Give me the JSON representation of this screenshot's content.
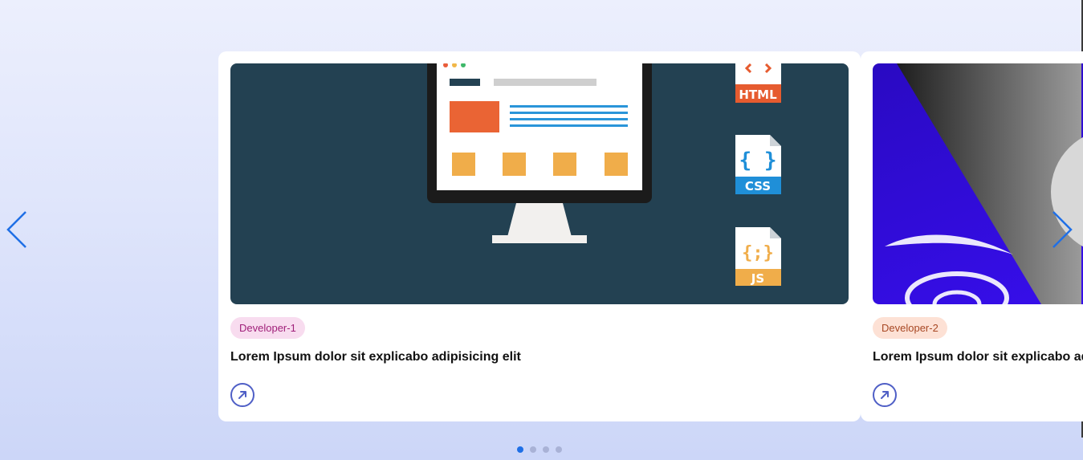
{
  "carousel": {
    "slides": [
      {
        "tag": "Developer-1",
        "title": "Lorem Ipsum dolor sit explicabo adipisicing elit",
        "image_icons": [
          "monitor-icon",
          "html-file-icon",
          "css-file-icon",
          "js-file-icon"
        ],
        "file_labels": {
          "html": "HTML",
          "css": "CSS",
          "js": "JS",
          "css_glyph": "{ }",
          "js_glyph": "{;}"
        }
      },
      {
        "tag": "Developer-2",
        "title": "Lorem Ipsum dolor sit explicabo adipisicing elit"
      }
    ],
    "dots_count": 4,
    "active_dot": 0
  },
  "colors": {
    "accent": "#1f6fe6",
    "link_icon": "#4f5fc6",
    "image_bg_1": "#234152"
  }
}
